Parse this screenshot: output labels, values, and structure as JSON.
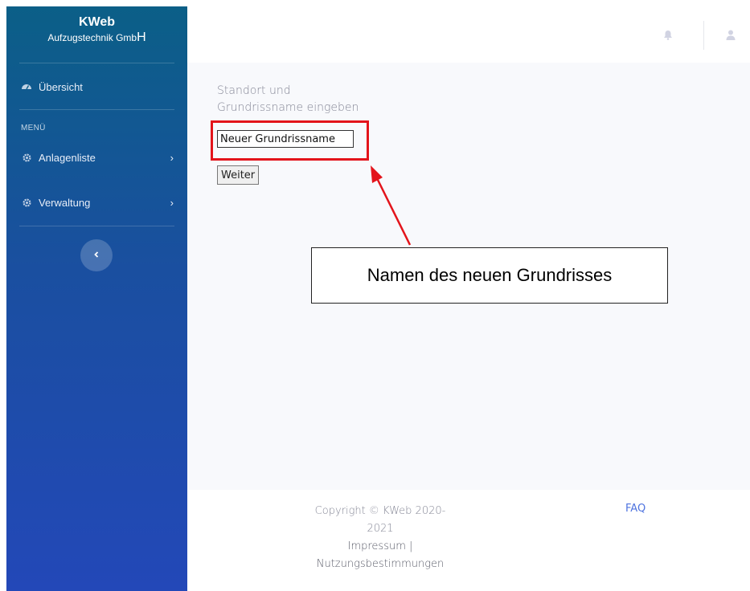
{
  "brand": {
    "name": "KWeb",
    "subtitle": "Aufzugstechnik Gmb",
    "subtitle_last": "H"
  },
  "sidebar": {
    "overview": {
      "label": "Übersicht",
      "icon": "dashboard-icon"
    },
    "section_label": "MENÜ",
    "items": [
      {
        "label": "Anlagenliste",
        "icon": "gear-icon",
        "chevron": "›"
      },
      {
        "label": "Verwaltung",
        "icon": "gear-icon",
        "chevron": "›"
      }
    ],
    "collapse_icon": "chevron-left-icon"
  },
  "topbar": {
    "icons": [
      "bell-icon",
      "user-icon"
    ]
  },
  "main": {
    "prompt_line1": "Standort und",
    "prompt_line2": "Grundrissname eingeben",
    "input_value": "Neuer Grundrissname",
    "button_label": "Weiter"
  },
  "annotation": {
    "callout_text": "Namen des neuen Grundrisses",
    "color": "#e3141b"
  },
  "footer": {
    "copyright_line1": "Copyright © KWeb 2020-",
    "copyright_line2": "2021",
    "impressum": "Impressum",
    "separator": " |",
    "terms": "Nutzungsbestimmungen",
    "faq": "FAQ"
  },
  "colors": {
    "sidebar_top": "#0b5f87",
    "sidebar_bottom": "#2348b8",
    "link": "#4e73df"
  }
}
